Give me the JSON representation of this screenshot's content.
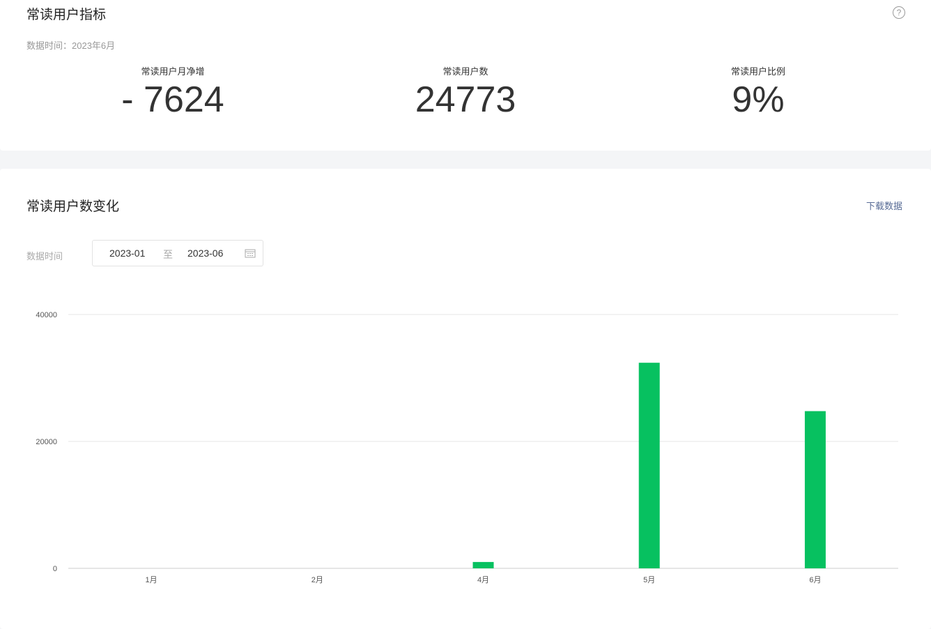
{
  "metrics": {
    "title": "常读用户指标",
    "data_time": "数据时间：2023年6月",
    "stats": [
      {
        "label": "常读用户月净增",
        "value": "- 7624"
      },
      {
        "label": "常读用户数",
        "value": "24773"
      },
      {
        "label": "常读用户比例",
        "value": "9%"
      }
    ]
  },
  "trend": {
    "title": "常读用户数变化",
    "download": "下载数据",
    "date_label": "数据时间",
    "start": "2023-01",
    "sep": "至",
    "end": "2023-06"
  },
  "chart_data": {
    "type": "bar",
    "categories": [
      "1月",
      "2月",
      "4月",
      "5月",
      "6月"
    ],
    "values": [
      0,
      0,
      1000,
      32397,
      24773
    ],
    "ylim": [
      0,
      40000
    ],
    "yticks": [
      0,
      20000,
      40000
    ],
    "yticks_labels": [
      "0",
      "20000",
      "40000"
    ],
    "color": "#07c160",
    "grid": true
  }
}
